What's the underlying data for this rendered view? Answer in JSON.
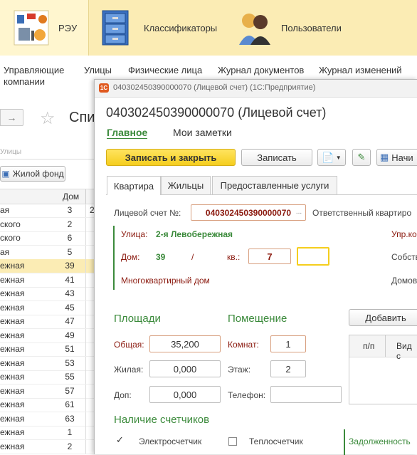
{
  "sections": {
    "reu": "РЭУ",
    "classifiers": "Классификаторы",
    "users": "Пользователи"
  },
  "nav": {
    "items": [
      "Управляющие компании",
      "Улицы",
      "Физические лица",
      "Журнал документов",
      "Журнал изменений"
    ]
  },
  "left_pane": {
    "title": "Спи",
    "search_label": "Улицы",
    "housing_button": "Жилой фонд",
    "col_house": "Дом",
    "rows": [
      {
        "street": "ая",
        "house": "3"
      },
      {
        "street": "ского",
        "house": "2"
      },
      {
        "street": "ского",
        "house": "6"
      },
      {
        "street": "ая",
        "house": "5"
      },
      {
        "street": "ежная",
        "house": "39"
      },
      {
        "street": "ежная",
        "house": "41"
      },
      {
        "street": "ежная",
        "house": "43"
      },
      {
        "street": "ежная",
        "house": "45"
      },
      {
        "street": "ежная",
        "house": "47"
      },
      {
        "street": "ежная",
        "house": "49"
      },
      {
        "street": "ежная",
        "house": "51"
      },
      {
        "street": "ежная",
        "house": "53"
      },
      {
        "street": "ежная",
        "house": "55"
      },
      {
        "street": "ежная",
        "house": "57"
      },
      {
        "street": "ежная",
        "house": "61"
      },
      {
        "street": "ежная",
        "house": "63"
      },
      {
        "street": "ежная",
        "house": "1"
      },
      {
        "street": "ежная",
        "house": "2"
      }
    ],
    "partial_value": "2"
  },
  "window": {
    "titlebar": "040302450390000070 (Лицевой счет) (1С:Предприятие)",
    "heading": "040302450390000070 (Лицевой счет)",
    "link_main": "Главное",
    "link_notes": "Мои заметки",
    "btn_save_close": "Записать и закрыть",
    "btn_save": "Записать",
    "btn_start": "Начи",
    "tabs": [
      "Квартира",
      "Жильцы",
      "Предоставленные услуги"
    ],
    "account_label": "Лицевой счет №:",
    "account_value": "040302450390000070",
    "responsible_label": "Ответственный квартиро",
    "street_label": "Улица:",
    "street_value": "2-я Левобережная",
    "house_label": "Дом:",
    "house_value": "39",
    "slash": "/",
    "apt_label": "кв.:",
    "apt_value": "7",
    "building_type": "Многоквартирный дом",
    "upr_label": "Упр.ко",
    "owner_label": "Собств",
    "dom_label": "Домов",
    "areas_header": "Площади",
    "room_header": "Помещение",
    "add_button": "Добавить",
    "total_label": "Общая:",
    "total_value": "35,200",
    "living_label": "Жилая:",
    "living_value": "0,000",
    "extra_label": "Доп:",
    "extra_value": "0,000",
    "rooms_label": "Комнат:",
    "rooms_value": "1",
    "floor_label": "Этаж:",
    "floor_value": "2",
    "phone_label": "Телефон:",
    "phone_value": "",
    "table_col1": "п/п",
    "table_col2": "Вид с",
    "meters_header": "Наличие счетчиков",
    "electric_label": "Электросчетчик",
    "heat_label": "Теплосчетчик",
    "debt_label": "Задолженность"
  },
  "colors": {
    "accent_green": "#3b8a3b",
    "account_red": "#8b1a0f",
    "topbar": "#fbecb4",
    "button_yellow": "#f5ce1d"
  }
}
